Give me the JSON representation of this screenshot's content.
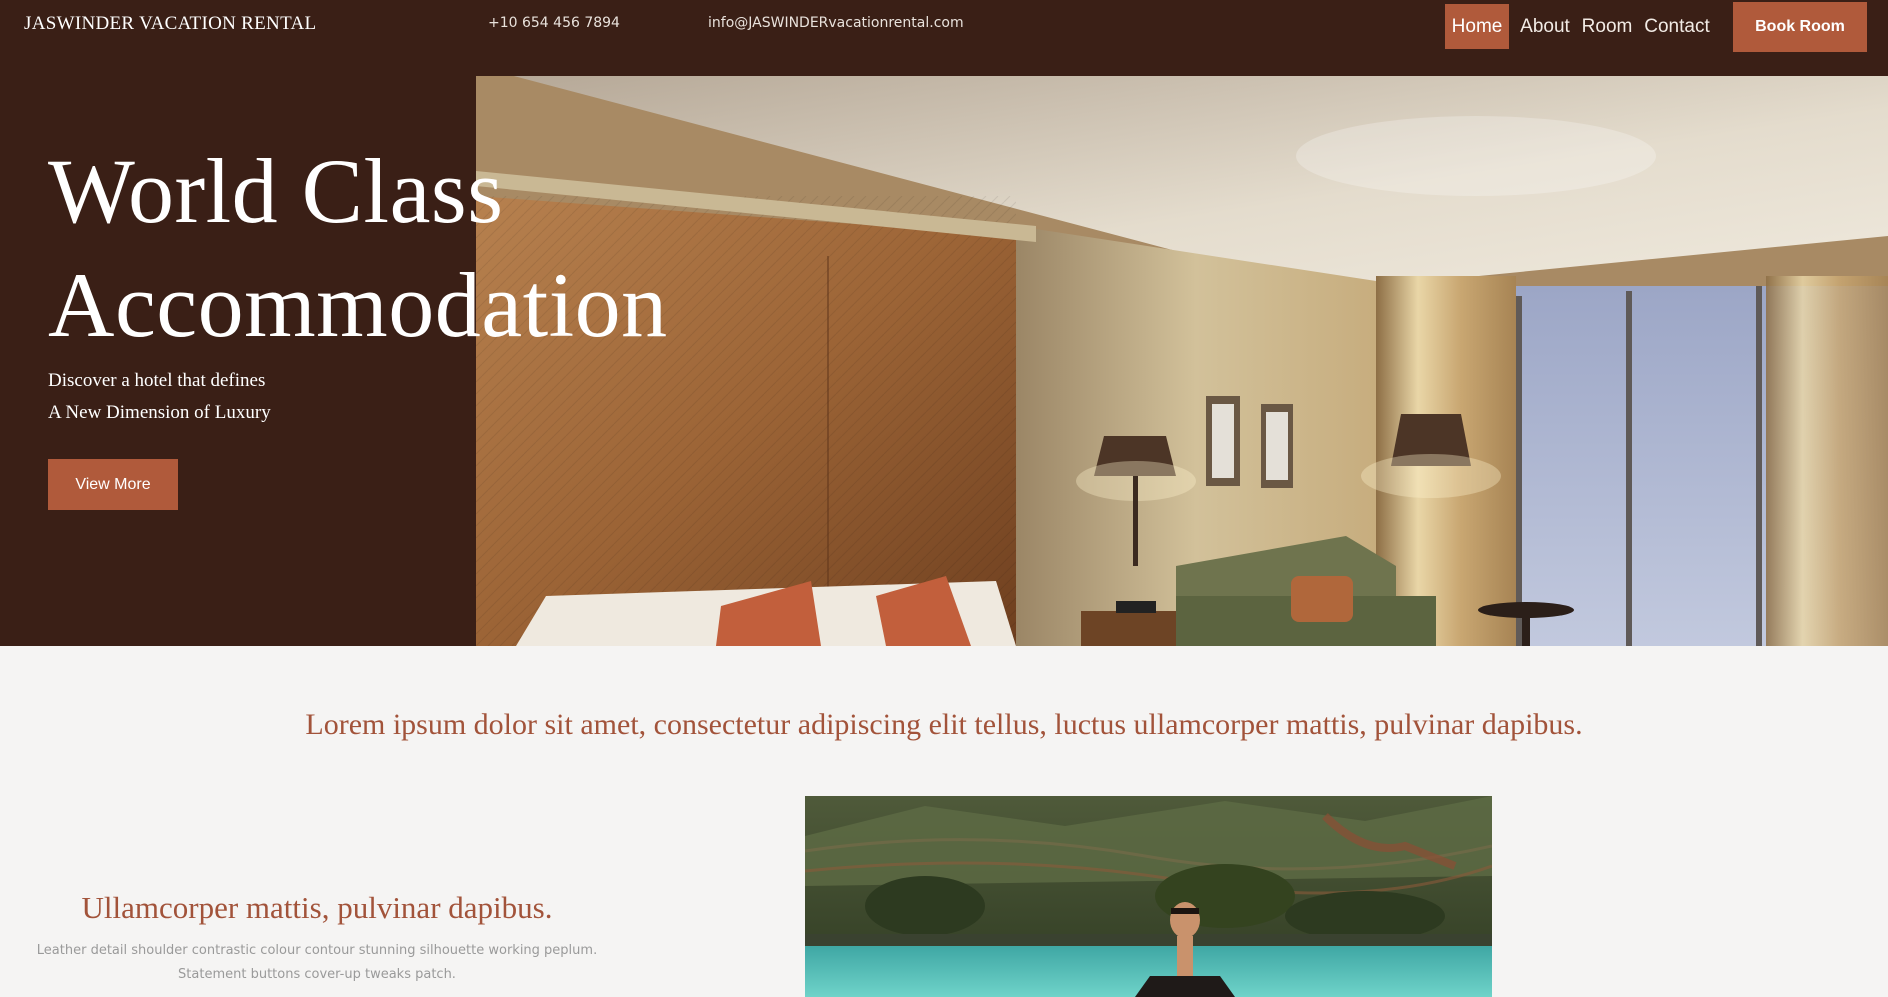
{
  "header": {
    "brand": "JASWINDER VACATION RENTAL",
    "phone": "+10 654 456 7894",
    "email": "info@JASWINDERvacationrental.com",
    "nav": [
      {
        "label": "Home",
        "active": true
      },
      {
        "label": "About",
        "active": false
      },
      {
        "label": "Room",
        "active": false
      },
      {
        "label": "Contact",
        "active": false
      }
    ],
    "book_button": "Book Room"
  },
  "hero": {
    "title_line1": "World Class",
    "title_line2": "Accommodation",
    "subtitle_line1": "Discover a hotel that defines",
    "subtitle_line2": "A New Dimension of Luxury",
    "cta": "View More"
  },
  "intro": {
    "tagline": "Lorem ipsum dolor sit amet, consectetur adipiscing elit tellus, luctus ullamcorper mattis, pulvinar dapibus."
  },
  "feature": {
    "title": "Ullamcorper mattis, pulvinar dapibus.",
    "text_line1": "Leather detail shoulder contrastic colour contour stunning silhouette working peplum.",
    "text_line2": "Statement buttons cover-up tweaks patch."
  },
  "colors": {
    "dark_brown": "#3a1f16",
    "accent": "#b05a3b",
    "heading_rust": "#a2533a",
    "background": "#f5f4f3"
  }
}
